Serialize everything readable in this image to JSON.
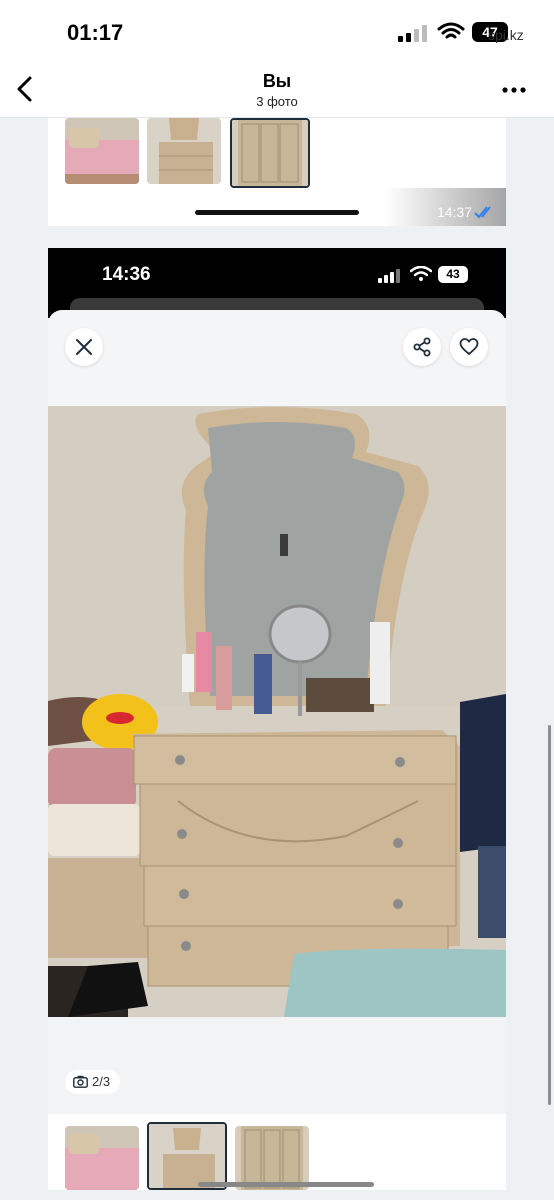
{
  "status_bar": {
    "time": "01:17",
    "battery": "47",
    "site": "spi.kz"
  },
  "header": {
    "title": "Вы",
    "subtitle": "3 фото"
  },
  "first_message": {
    "time": "14:37"
  },
  "second_message": {
    "screenshot_status": {
      "time": "14:36",
      "battery": "43"
    },
    "photo_counter": "2/3"
  },
  "colors": {
    "header_bg": "#ffffff",
    "page_bg": "#eef1f4",
    "selected_thumb_border": "#1f2e3a",
    "read_ticks": "#2f80ed"
  },
  "icons": {
    "back": "chevron-left-icon",
    "more": "more-dots-icon",
    "close": "close-icon",
    "share": "share-icon",
    "favorite": "heart-icon",
    "camera": "camera-icon"
  }
}
